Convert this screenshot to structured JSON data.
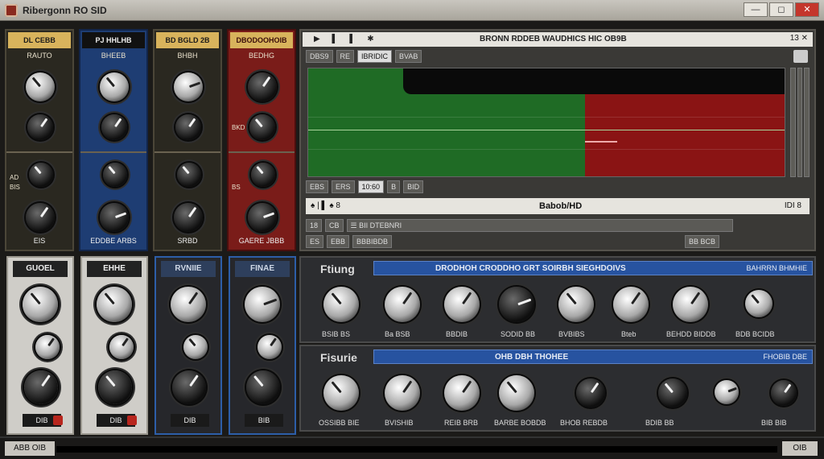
{
  "window": {
    "title": "Ribergonn RO SID",
    "buttons": [
      "—",
      "◻",
      "✕"
    ]
  },
  "strips": [
    {
      "head": "DL CEBB",
      "sub": "RAUTO",
      "side": [
        "AD",
        "BIS"
      ],
      "foot": "EIS"
    },
    {
      "head": "PJ HHLHB",
      "sub": "BHEEB",
      "side": [],
      "foot": "EDDBE ARBS"
    },
    {
      "head": "BD BGLD 2B",
      "sub": "BHBH",
      "side": [],
      "foot": "SRBD"
    },
    {
      "head": "DBODOOHOIB",
      "sub": "BEDHG",
      "side": [
        "BKD",
        "BS"
      ],
      "foot": "GAERE JBBB"
    }
  ],
  "modules": [
    {
      "head": "GUOEL",
      "foot": "DIB"
    },
    {
      "head": "EHHE",
      "foot": "DIB"
    },
    {
      "head": "RVNIIE",
      "foot": "DIB"
    },
    {
      "head": "FINAE",
      "foot": "BIB"
    }
  ],
  "editor": {
    "icons": "▶ ▌ ▌ ✱",
    "title": "BRONN RDDEB WAUDHICS HIC OB9B",
    "ctrl": "13 ✕",
    "tb1": [
      "DBS9",
      "RE",
      "IBRIDIC",
      "BVAB"
    ],
    "tb2": [
      "EBS",
      "ERS",
      "10:60",
      "B",
      "BID"
    ],
    "transport": "♠ | ▌ ♠ 8",
    "transport_title": "Babob/HD",
    "transport_right": "IDI 8",
    "tb3": [
      "18",
      "CB",
      "☰ BII DTEBNRI"
    ],
    "tb4": [
      "ES",
      "EBB",
      "BBBIBDB",
      "BB BCB"
    ]
  },
  "graph": {
    "chart_data": {
      "type": "area",
      "series": [
        {
          "name": "",
          "color": "#1f6b25"
        },
        {
          "name": "",
          "color": "#8a1414"
        }
      ]
    }
  },
  "param_rows": [
    {
      "title": "Ftiung",
      "bar": "DRODHOH CRODDHO GRT SOIRBH SIEGHDOIVS",
      "bar_right": "BAHRRN BHMHIE",
      "labels": [
        "BSIB BS",
        "Ba BSB",
        "BBDIB",
        "SODID BB",
        "BVBIBS",
        "Bteb",
        "BEHDD BIDDB",
        "BDB BCIDB"
      ]
    },
    {
      "title": "Fisurie",
      "bar": "OHB DBH THOHEE",
      "bar_right": "FHOBIB DBE",
      "labels": [
        "OSSIBB BIE",
        "BVISHIB",
        "REIB BRB",
        "BARBE BOBDB",
        "BHOB REBDB",
        "BDIB BB",
        "BIB BIB"
      ]
    }
  ],
  "status": {
    "left": "ABB OIB",
    "right": "OIB"
  },
  "colors": {
    "blue": "#2753a0",
    "red": "#8a1414",
    "green": "#1f6b25",
    "gold": "#d8b35c"
  }
}
